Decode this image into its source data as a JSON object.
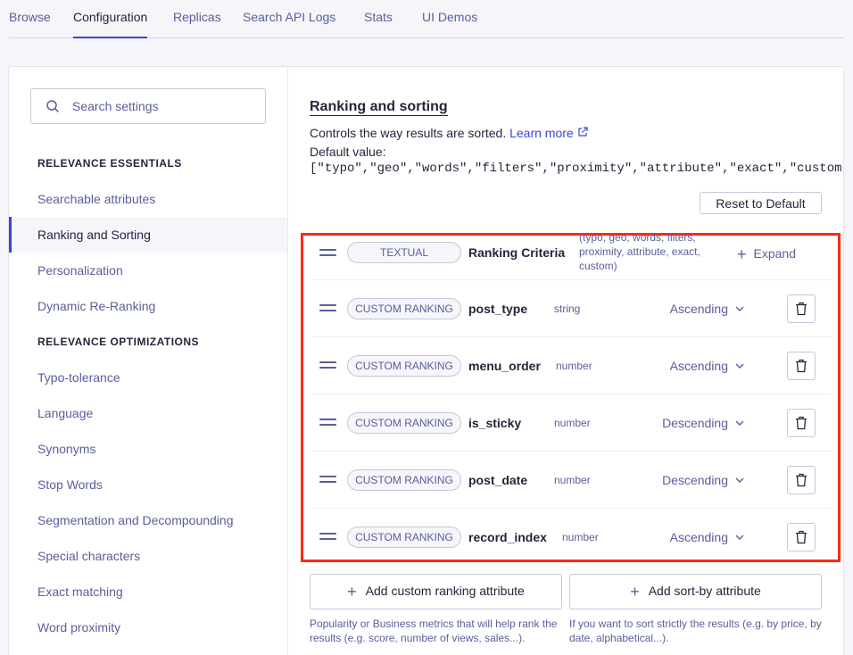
{
  "tabs": [
    "Browse",
    "Configuration",
    "Replicas",
    "Search API Logs",
    "Stats",
    "UI Demos"
  ],
  "active_tab": "Configuration",
  "sidebar": {
    "search_placeholder": "Search settings",
    "section1": "RELEVANCE ESSENTIALS",
    "items1": [
      "Searchable attributes",
      "Ranking and Sorting",
      "Personalization",
      "Dynamic Re-Ranking"
    ],
    "section2": "RELEVANCE OPTIMIZATIONS",
    "items2": [
      "Typo-tolerance",
      "Language",
      "Synonyms",
      "Stop Words",
      "Segmentation and Decompounding",
      "Special characters",
      "Exact matching",
      "Word proximity"
    ],
    "active_item": "Ranking and Sorting"
  },
  "main": {
    "title": "Ranking and sorting",
    "description": "Controls the way results are sorted.",
    "learn_more": "Learn more",
    "default_label": "Default value:",
    "default_value": "[\"typo\",\"geo\",\"words\",\"filters\",\"proximity\",\"attribute\",\"exact\",\"custom\"]",
    "reset_label": "Reset to Default",
    "textual": {
      "pill": "TEXTUAL",
      "name": "Ranking Criteria",
      "criteria": "(typo, geo, words, filters, proximity, attribute, exact, custom)",
      "expand": "Expand"
    },
    "rows": [
      {
        "pill": "CUSTOM RANKING",
        "name": "post_type",
        "type": "string",
        "order": "Ascending"
      },
      {
        "pill": "CUSTOM RANKING",
        "name": "menu_order",
        "type": "number",
        "order": "Ascending"
      },
      {
        "pill": "CUSTOM RANKING",
        "name": "is_sticky",
        "type": "number",
        "order": "Descending"
      },
      {
        "pill": "CUSTOM RANKING",
        "name": "post_date",
        "type": "number",
        "order": "Descending"
      },
      {
        "pill": "CUSTOM RANKING",
        "name": "record_index",
        "type": "number",
        "order": "Ascending"
      }
    ],
    "add_custom_label": "Add custom ranking attribute",
    "add_sortby_label": "Add sort-by attribute",
    "custom_hint": "Popularity or Business metrics that will help rank the results (e.g. score, number of views, sales...).",
    "sortby_hint": "If you want to sort strictly the results (e.g. by price, by date, alphabetical...)."
  },
  "colors": {
    "accent": "#3a46d4",
    "highlight_border": "#ff2a0f",
    "muted_text": "#5a5e9a"
  }
}
